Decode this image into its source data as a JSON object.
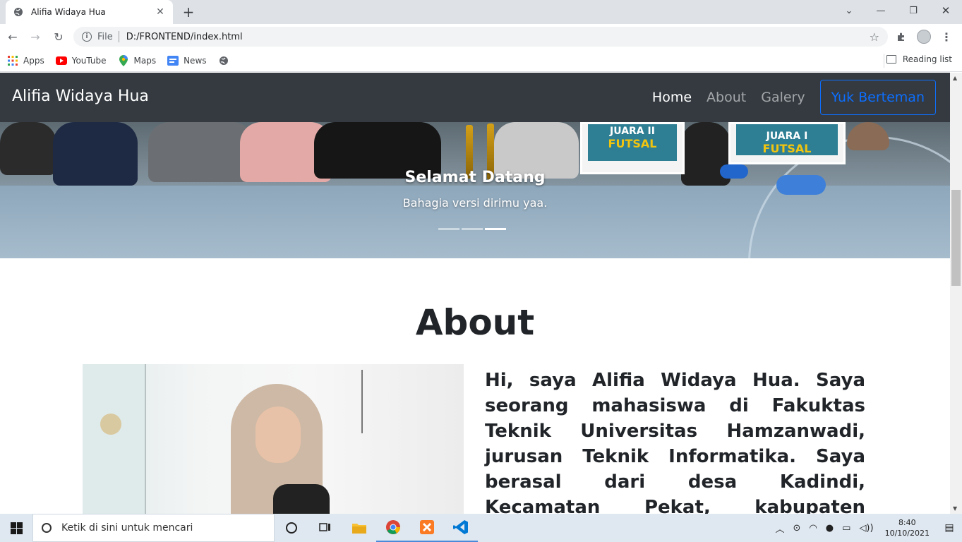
{
  "browser": {
    "tab_title": "Alifia Widaya Hua",
    "address_scheme": "File",
    "address_url": "D:/FRONTEND/index.html",
    "bookmarks": [
      {
        "label": "Apps",
        "icon": "apps-grid-icon"
      },
      {
        "label": "YouTube",
        "icon": "youtube-icon"
      },
      {
        "label": "Maps",
        "icon": "maps-icon"
      },
      {
        "label": "News",
        "icon": "news-icon"
      }
    ],
    "reading_list": "Reading list"
  },
  "site": {
    "brand": "Alifia Widaya Hua",
    "nav": {
      "home": "Home",
      "about": "About",
      "galery": "Galery",
      "cta": "Yuk Berteman"
    },
    "hero": {
      "banner_line1": "JUARA II",
      "banner_line2": "FUTSAL",
      "banner2_line1": "JUARA I",
      "banner2_line2": "FUTSAL",
      "caption_title": "Selamat Datang",
      "caption_text": "Bahagia versi dirimu yaa.",
      "active_slide": 3,
      "slide_count": 3
    },
    "about": {
      "title": "About",
      "text": "Hi, saya Alifia Widaya Hua. Saya seorang mahasiswa di Fakuktas Teknik Universitas Hamzanwadi, jurusan Teknik Informatika. Saya berasal dari desa Kadindi, Kecamatan Pekat, kabupaten Dompu, NTB. Motto Hidup"
    }
  },
  "taskbar": {
    "search_placeholder": "Ketik di sini untuk mencari",
    "time": "8:40",
    "date": "10/10/2021"
  },
  "colors": {
    "navbar": "#343a40",
    "primary": "#0d6efd"
  }
}
